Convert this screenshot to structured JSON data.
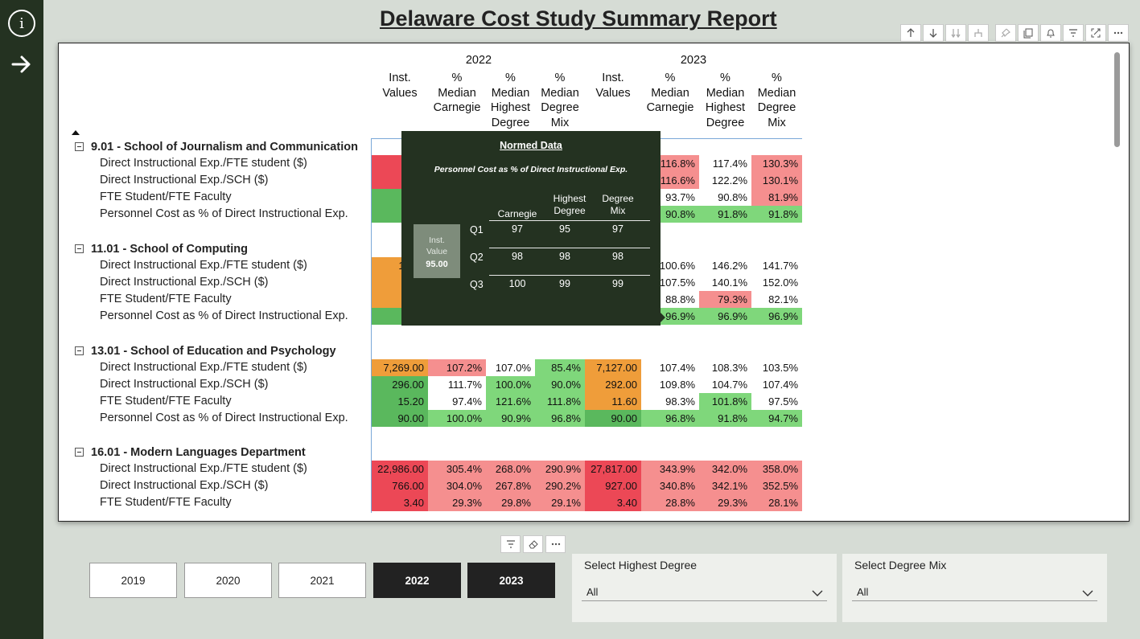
{
  "page": {
    "title": "Delaware Cost Study Summary Report"
  },
  "rail": {
    "info_icon_glyph": "i"
  },
  "matrix": {
    "years": [
      "2022",
      "2023"
    ],
    "column_headers": [
      [
        "Inst.",
        "Values"
      ],
      [
        "%",
        "Median",
        "Carnegie"
      ],
      [
        "%",
        "Median",
        "Highest",
        "Degree"
      ],
      [
        "%",
        "Median",
        "Degree",
        "Mix"
      ],
      [
        "Inst.",
        "Values"
      ],
      [
        "%",
        "Median",
        "Carnegie"
      ],
      [
        "%",
        "Median",
        "Highest",
        "Degree"
      ],
      [
        "%",
        "Median",
        "Degree",
        "Mix"
      ]
    ],
    "groups": [
      {
        "name": "9.01 - School of Journalism and Communication",
        "rows": [
          {
            "label": "Direct Instructional Exp./FTE student ($)",
            "cells": [
              [
                "9,67",
                "red"
              ],
              [
                "",
                ""
              ],
              [
                "",
                ""
              ],
              [
                "",
                ""
              ],
              [
                "",
                ""
              ],
              [
                "116.8%",
                "pink"
              ],
              [
                "117.4%",
                ""
              ],
              [
                "130.3%",
                "pink"
              ]
            ]
          },
          {
            "label": "Direct Instructional Exp./SCH ($)",
            "cells": [
              [
                "32",
                "red"
              ],
              [
                "",
                ""
              ],
              [
                "",
                ""
              ],
              [
                "",
                ""
              ],
              [
                "",
                ""
              ],
              [
                "116.6%",
                "pink"
              ],
              [
                "122.2%",
                ""
              ],
              [
                "130.1%",
                "pink"
              ]
            ]
          },
          {
            "label": "FTE Student/FTE Faculty",
            "cells": [
              [
                "1",
                "green"
              ],
              [
                "",
                ""
              ],
              [
                "",
                ""
              ],
              [
                "",
                ""
              ],
              [
                "",
                ""
              ],
              [
                "93.7%",
                ""
              ],
              [
                "90.8%",
                ""
              ],
              [
                "81.9%",
                "pink"
              ]
            ]
          },
          {
            "label": "Personnel Cost as % of Direct Instructional Exp.",
            "cells": [
              [
                "9",
                "green"
              ],
              [
                "",
                ""
              ],
              [
                "",
                ""
              ],
              [
                "",
                ""
              ],
              [
                "",
                ""
              ],
              [
                "90.8%",
                "lgreen"
              ],
              [
                "91.8%",
                "lgreen"
              ],
              [
                "91.8%",
                "lgreen"
              ]
            ]
          }
        ]
      },
      {
        "name": "11.01 - School of Computing",
        "rows": [
          {
            "label": "Direct Instructional Exp./FTE student ($)",
            "cells": [
              [
                "11,23",
                "orange"
              ],
              [
                "",
                ""
              ],
              [
                "",
                ""
              ],
              [
                "",
                ""
              ],
              [
                "",
                ""
              ],
              [
                "100.6%",
                ""
              ],
              [
                "146.2%",
                ""
              ],
              [
                "141.7%",
                ""
              ]
            ]
          },
          {
            "label": "Direct Instructional Exp./SCH ($)",
            "cells": [
              [
                "39",
                "orange"
              ],
              [
                "",
                ""
              ],
              [
                "",
                ""
              ],
              [
                "",
                ""
              ],
              [
                "",
                ""
              ],
              [
                "107.5%",
                ""
              ],
              [
                "140.1%",
                ""
              ],
              [
                "152.0%",
                ""
              ]
            ]
          },
          {
            "label": "FTE Student/FTE Faculty",
            "cells": [
              [
                "1",
                "orange"
              ],
              [
                "",
                ""
              ],
              [
                "",
                ""
              ],
              [
                "",
                ""
              ],
              [
                "",
                ""
              ],
              [
                "88.8%",
                ""
              ],
              [
                "79.3%",
                "pink"
              ],
              [
                "82.1%",
                ""
              ]
            ]
          },
          {
            "label": "Personnel Cost as % of Direct Instructional Exp.",
            "cells": [
              [
                "9",
                "green"
              ],
              [
                "",
                ""
              ],
              [
                "",
                ""
              ],
              [
                "",
                ""
              ],
              [
                "",
                ""
              ],
              [
                "96.9%",
                "lgreen"
              ],
              [
                "96.9%",
                "lgreen"
              ],
              [
                "96.9%",
                "lgreen"
              ]
            ]
          }
        ]
      },
      {
        "name": "13.01 - School of Education and Psychology",
        "rows": [
          {
            "label": "Direct Instructional Exp./FTE student ($)",
            "cells": [
              [
                "7,269.00",
                "orange"
              ],
              [
                "107.2%",
                "pink"
              ],
              [
                "107.0%",
                ""
              ],
              [
                "85.4%",
                "lgreen"
              ],
              [
                "7,127.00",
                "orange"
              ],
              [
                "107.4%",
                ""
              ],
              [
                "108.3%",
                ""
              ],
              [
                "103.5%",
                ""
              ]
            ]
          },
          {
            "label": "Direct Instructional Exp./SCH ($)",
            "cells": [
              [
                "296.00",
                "green"
              ],
              [
                "111.7%",
                ""
              ],
              [
                "100.0%",
                "lgreen"
              ],
              [
                "90.0%",
                "lgreen"
              ],
              [
                "292.00",
                "orange"
              ],
              [
                "109.8%",
                ""
              ],
              [
                "104.7%",
                ""
              ],
              [
                "107.4%",
                ""
              ]
            ]
          },
          {
            "label": "FTE Student/FTE Faculty",
            "cells": [
              [
                "15.20",
                "green"
              ],
              [
                "97.4%",
                ""
              ],
              [
                "121.6%",
                "lgreen"
              ],
              [
                "111.8%",
                "lgreen"
              ],
              [
                "11.60",
                "orange"
              ],
              [
                "98.3%",
                ""
              ],
              [
                "101.8%",
                "lgreen"
              ],
              [
                "97.5%",
                ""
              ]
            ]
          },
          {
            "label": "Personnel Cost as % of Direct Instructional Exp.",
            "cells": [
              [
                "90.00",
                "green"
              ],
              [
                "100.0%",
                "lgreen"
              ],
              [
                "90.9%",
                "lgreen"
              ],
              [
                "96.8%",
                "lgreen"
              ],
              [
                "90.00",
                "green"
              ],
              [
                "96.8%",
                "lgreen"
              ],
              [
                "91.8%",
                "lgreen"
              ],
              [
                "94.7%",
                "lgreen"
              ]
            ]
          }
        ]
      },
      {
        "name": "16.01 - Modern Languages Department",
        "rows": [
          {
            "label": "Direct Instructional Exp./FTE student ($)",
            "cells": [
              [
                "22,986.00",
                "red"
              ],
              [
                "305.4%",
                "pink"
              ],
              [
                "268.0%",
                "pink"
              ],
              [
                "290.9%",
                "pink"
              ],
              [
                "27,817.00",
                "red"
              ],
              [
                "343.9%",
                "pink"
              ],
              [
                "342.0%",
                "pink"
              ],
              [
                "358.0%",
                "pink"
              ]
            ]
          },
          {
            "label": "Direct Instructional Exp./SCH ($)",
            "cells": [
              [
                "766.00",
                "red"
              ],
              [
                "304.0%",
                "pink"
              ],
              [
                "267.8%",
                "pink"
              ],
              [
                "290.2%",
                "pink"
              ],
              [
                "927.00",
                "red"
              ],
              [
                "340.8%",
                "pink"
              ],
              [
                "342.1%",
                "pink"
              ],
              [
                "352.5%",
                "pink"
              ]
            ]
          },
          {
            "label": "FTE Student/FTE Faculty",
            "cells": [
              [
                "3.40",
                "red"
              ],
              [
                "29.3%",
                "pink"
              ],
              [
                "29.8%",
                "pink"
              ],
              [
                "29.1%",
                "pink"
              ],
              [
                "3.40",
                "red"
              ],
              [
                "28.8%",
                "pink"
              ],
              [
                "29.3%",
                "pink"
              ],
              [
                "28.1%",
                "pink"
              ]
            ]
          }
        ]
      }
    ]
  },
  "tooltip": {
    "title": "Normed Data",
    "subtitle": "Personnel Cost as % of Direct Instructional Exp.",
    "inst_label_1": "Inst.",
    "inst_label_2": "Value",
    "inst_value": "95.00",
    "col_headers": [
      [
        "Carnegie"
      ],
      [
        "Highest",
        "Degree"
      ],
      [
        "Degree",
        "Mix"
      ]
    ],
    "rows": [
      {
        "q": "Q1",
        "values": [
          "97",
          "95",
          "97"
        ]
      },
      {
        "q": "Q2",
        "values": [
          "98",
          "98",
          "98"
        ]
      },
      {
        "q": "Q3",
        "values": [
          "100",
          "99",
          "99"
        ]
      }
    ]
  },
  "year_buttons": [
    {
      "label": "2019",
      "selected": false
    },
    {
      "label": "2020",
      "selected": false
    },
    {
      "label": "2021",
      "selected": false
    },
    {
      "label": "2022",
      "selected": true
    },
    {
      "label": "2023",
      "selected": true
    }
  ],
  "dropdowns": [
    {
      "title": "Select Highest Degree",
      "value": "All"
    },
    {
      "title": "Select Degree Mix",
      "value": "All"
    }
  ],
  "colors": {
    "rail": "#243221",
    "background": "#d6dcd5",
    "red": "#ec4856",
    "pink": "#f58f8f",
    "orange": "#ef9d3a",
    "green": "#5ab85d",
    "light_green": "#7fd77b"
  },
  "icons": {
    "visual_header": [
      "arrow-up-icon",
      "arrow-down-icon",
      "double-arrow-down-icon",
      "expand-hierarchy-icon",
      "pin-icon",
      "copy-icon",
      "bell-icon",
      "filter-icon",
      "focus-mode-icon",
      "more-options-icon"
    ],
    "slicer_header": [
      "filter-icon",
      "eraser-icon",
      "more-options-icon"
    ]
  }
}
